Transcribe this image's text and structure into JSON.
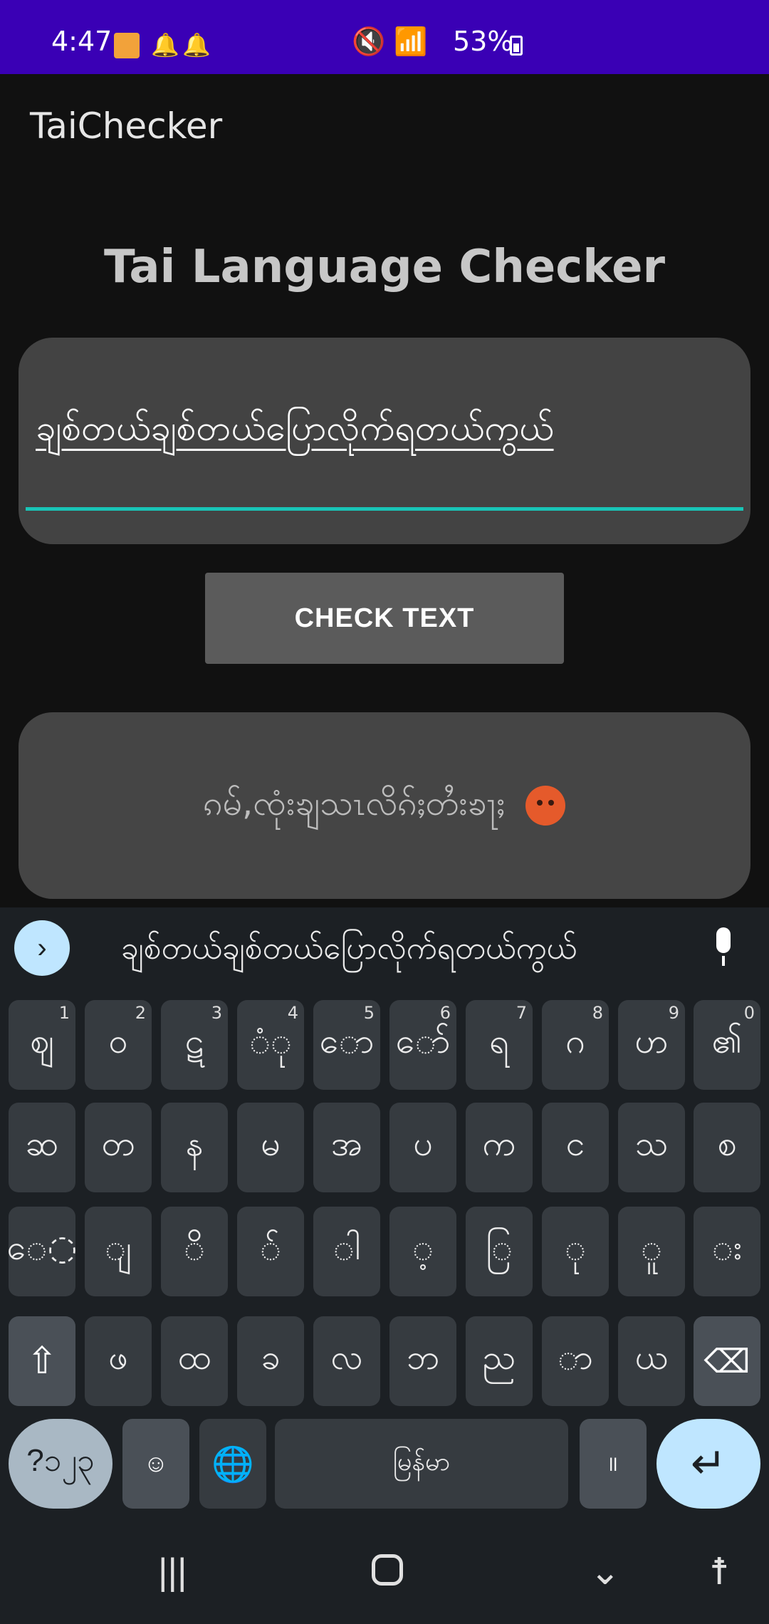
{
  "status_bar": {
    "time": "4:47",
    "app_icon": "app-notification-icon",
    "bells": [
      "🔔",
      "🔔"
    ],
    "icons_right": "🔇 📶",
    "battery_text": "53%"
  },
  "app_bar": {
    "title": "TaiChecker"
  },
  "main": {
    "heading": "Tai Language Checker",
    "input_value": "ချစ်တယ်ချစ်တယ်ပြောလိုက်ရတယ်ကွယ်",
    "check_button_label": "CHECK TEXT",
    "result_text": "ၵမ်,ၸုံးၶျသၤလိၵ်ႈတႆးၶႃႈ",
    "result_emoji": "angry-face-icon"
  },
  "keyboard": {
    "suggestion": "ချစ်တယ်ချစ်တယ်ပြောလိုက်ရတယ်ကွယ်",
    "row1": [
      {
        "label": "ဈ",
        "hint": "1"
      },
      {
        "label": "ဝ",
        "hint": "2"
      },
      {
        "label": "ဋ",
        "hint": "3"
      },
      {
        "label": "◌ံု",
        "hint": "4"
      },
      {
        "label": "ော",
        "hint": "5"
      },
      {
        "label": "ော်",
        "hint": "6"
      },
      {
        "label": "ရ",
        "hint": "7"
      },
      {
        "label": "ဂ",
        "hint": "8"
      },
      {
        "label": "ဟ",
        "hint": "9"
      },
      {
        "label": "၏",
        "hint": "0"
      }
    ],
    "row2": [
      "ဆ",
      "တ",
      "န",
      "မ",
      "အ",
      "ပ",
      "က",
      "င",
      "သ",
      "စ"
    ],
    "row3": [
      "ေ◌",
      "◌ျ",
      "◌ိ",
      "◌်",
      "◌ါ",
      "◌့",
      "◌ြ",
      "◌ု",
      "◌ူ",
      "◌း"
    ],
    "row4": [
      "ဖ",
      "ထ",
      "ခ",
      "လ",
      "ဘ",
      "ည",
      "◌ာ",
      "ယ"
    ],
    "symbols_label": "?၁၂၃",
    "emoji_label": "☺",
    "space_label": "မြန်မာ",
    "period_label": "။",
    "enter_label": "↵"
  },
  "navbar": {
    "recents": "|||",
    "back": "⌄",
    "accessibility": "☨"
  }
}
